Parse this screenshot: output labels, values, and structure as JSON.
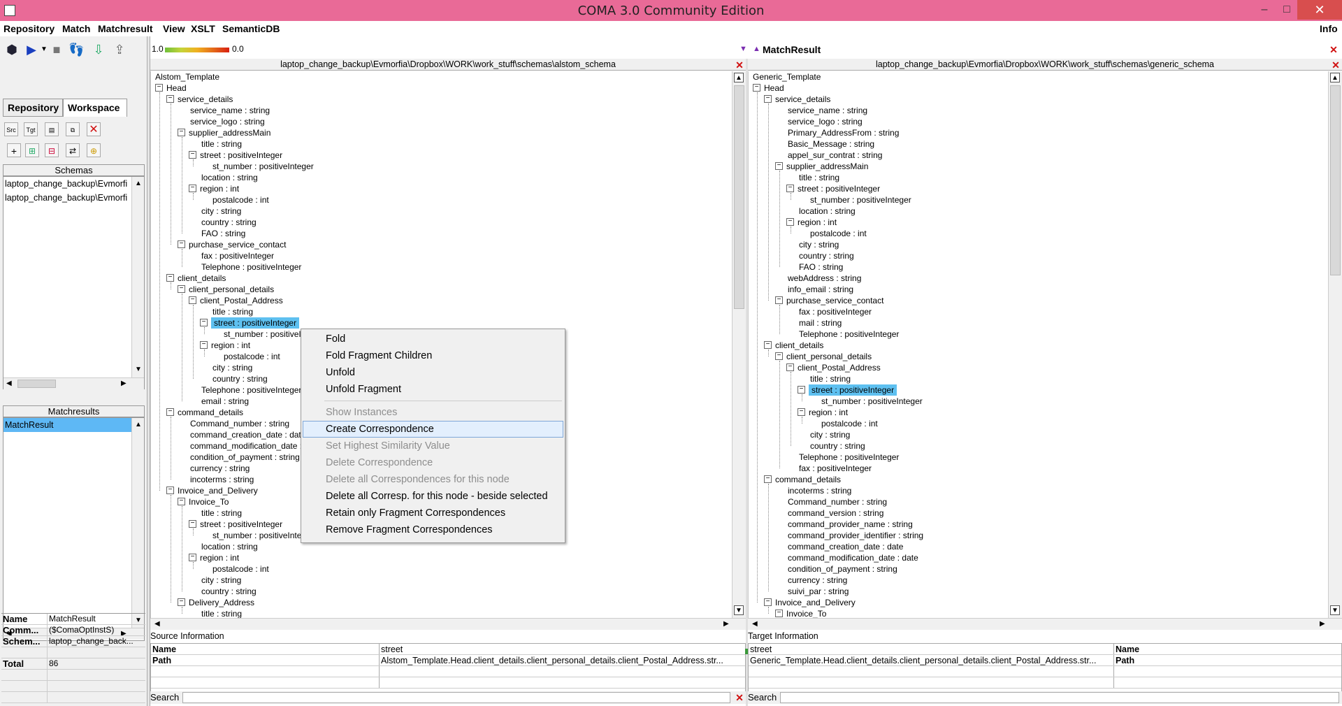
{
  "window": {
    "title": "COMA 3.0 Community Edition",
    "minimize": "–",
    "maximize": "□",
    "close": "✕"
  },
  "menu": [
    "Repository",
    "Match",
    "Matchresult",
    "View",
    "XSLT",
    "SemanticDB"
  ],
  "menu_right": "Info",
  "toolbar": {
    "scale_left": "1.0",
    "scale_right": "0.0"
  },
  "left_tabs": [
    "Repository",
    "Workspace"
  ],
  "schemas": {
    "header": "Schemas",
    "items": [
      "laptop_change_backup\\Evmorfi",
      "laptop_change_backup\\Evmorfi"
    ]
  },
  "matchresults": {
    "header": "Matchresults",
    "items": [
      "MatchResult"
    ]
  },
  "properties": [
    {
      "key": "Name",
      "value": "MatchResult"
    },
    {
      "key": "Comm...",
      "value": "($ComaOptInstS)"
    },
    {
      "key": "Schem...",
      "value": "laptop_change_back..."
    },
    {
      "key": "Total",
      "value": "86"
    }
  ],
  "matchresult_title": "MatchResult",
  "source": {
    "path": "laptop_change_backup\\Evmorfia\\Dropbox\\WORK\\work_stuff\\schemas\\alstom_schema",
    "tree": [
      {
        "t": "Alstom_Template",
        "l": 0,
        "e": null
      },
      {
        "t": "Head",
        "l": 0,
        "e": "-"
      },
      {
        "t": "service_details",
        "l": 1,
        "e": "-"
      },
      {
        "t": "service_name : string",
        "l": 2,
        "e": null
      },
      {
        "t": "service_logo : string",
        "l": 2,
        "e": null
      },
      {
        "t": "supplier_addressMain",
        "l": 2,
        "e": "-"
      },
      {
        "t": "title : string",
        "l": 3,
        "e": null
      },
      {
        "t": "street : positiveInteger",
        "l": 3,
        "e": "-"
      },
      {
        "t": "st_number : positiveInteger",
        "l": 4,
        "e": null
      },
      {
        "t": "location : string",
        "l": 3,
        "e": null
      },
      {
        "t": "region : int",
        "l": 3,
        "e": "-"
      },
      {
        "t": "postalcode : int",
        "l": 4,
        "e": null
      },
      {
        "t": "city : string",
        "l": 3,
        "e": null
      },
      {
        "t": "country : string",
        "l": 3,
        "e": null
      },
      {
        "t": "FAO : string",
        "l": 3,
        "e": null
      },
      {
        "t": "purchase_service_contact",
        "l": 2,
        "e": "-"
      },
      {
        "t": "fax : positiveInteger",
        "l": 3,
        "e": null
      },
      {
        "t": "Telephone : positiveInteger",
        "l": 3,
        "e": null
      },
      {
        "t": "client_details",
        "l": 1,
        "e": "-"
      },
      {
        "t": "client_personal_details",
        "l": 2,
        "e": "-"
      },
      {
        "t": "client_Postal_Address",
        "l": 3,
        "e": "-"
      },
      {
        "t": "title : string",
        "l": 4,
        "e": null
      },
      {
        "t": "street : positiveInteger",
        "l": 4,
        "e": "-",
        "sel": true
      },
      {
        "t": "st_number : positiveInteger",
        "l": 5,
        "e": null
      },
      {
        "t": "region : int",
        "l": 4,
        "e": "-"
      },
      {
        "t": "postalcode : int",
        "l": 5,
        "e": null
      },
      {
        "t": "city : string",
        "l": 4,
        "e": null
      },
      {
        "t": "country : string",
        "l": 4,
        "e": null
      },
      {
        "t": "Telephone : positiveInteger",
        "l": 3,
        "e": null
      },
      {
        "t": "email : string",
        "l": 3,
        "e": null
      },
      {
        "t": "command_details",
        "l": 1,
        "e": "-"
      },
      {
        "t": "Command_number : string",
        "l": 2,
        "e": null
      },
      {
        "t": "command_creation_date : date",
        "l": 2,
        "e": null
      },
      {
        "t": "command_modification_date : date",
        "l": 2,
        "e": null
      },
      {
        "t": "condition_of_payment : string",
        "l": 2,
        "e": null
      },
      {
        "t": "currency : string",
        "l": 2,
        "e": null
      },
      {
        "t": "incoterms : string",
        "l": 2,
        "e": null
      },
      {
        "t": "Invoice_and_Delivery",
        "l": 1,
        "e": "-"
      },
      {
        "t": "Invoice_To",
        "l": 2,
        "e": "-"
      },
      {
        "t": "title : string",
        "l": 3,
        "e": null
      },
      {
        "t": "street : positiveInteger",
        "l": 3,
        "e": "-"
      },
      {
        "t": "st_number : positiveInteger",
        "l": 4,
        "e": null
      },
      {
        "t": "location : string",
        "l": 3,
        "e": null
      },
      {
        "t": "region : int",
        "l": 3,
        "e": "-"
      },
      {
        "t": "postalcode : int",
        "l": 4,
        "e": null
      },
      {
        "t": "city : string",
        "l": 3,
        "e": null
      },
      {
        "t": "country : string",
        "l": 3,
        "e": null
      },
      {
        "t": "Delivery_Address",
        "l": 2,
        "e": "-"
      },
      {
        "t": "title : string",
        "l": 3,
        "e": null
      }
    ],
    "info_title": "Source Information",
    "info_rows": [
      {
        "k": "Name",
        "v": "street"
      },
      {
        "k": "Path",
        "v": "Alstom_Template.Head.client_details.client_personal_details.client_Postal_Address.str..."
      }
    ],
    "search_label": "Search"
  },
  "target": {
    "path": "laptop_change_backup\\Evmorfia\\Dropbox\\WORK\\work_stuff\\schemas\\generic_schema",
    "tree": [
      {
        "t": "Generic_Template",
        "l": 0,
        "e": null
      },
      {
        "t": "Head",
        "l": 0,
        "e": "-"
      },
      {
        "t": "service_details",
        "l": 1,
        "e": "-"
      },
      {
        "t": "service_name : string",
        "l": 2,
        "e": null
      },
      {
        "t": "service_logo : string",
        "l": 2,
        "e": null
      },
      {
        "t": "Primary_AddressFrom : string",
        "l": 2,
        "e": null
      },
      {
        "t": "Basic_Message : string",
        "l": 2,
        "e": null
      },
      {
        "t": "appel_sur_contrat : string",
        "l": 2,
        "e": null
      },
      {
        "t": "supplier_addressMain",
        "l": 2,
        "e": "-"
      },
      {
        "t": "title : string",
        "l": 3,
        "e": null
      },
      {
        "t": "street : positiveInteger",
        "l": 3,
        "e": "-"
      },
      {
        "t": "st_number : positiveInteger",
        "l": 4,
        "e": null
      },
      {
        "t": "location : string",
        "l": 3,
        "e": null
      },
      {
        "t": "region : int",
        "l": 3,
        "e": "-"
      },
      {
        "t": "postalcode : int",
        "l": 4,
        "e": null
      },
      {
        "t": "city : string",
        "l": 3,
        "e": null
      },
      {
        "t": "country : string",
        "l": 3,
        "e": null
      },
      {
        "t": "FAO : string",
        "l": 3,
        "e": null
      },
      {
        "t": "webAddress : string",
        "l": 2,
        "e": null
      },
      {
        "t": "info_email : string",
        "l": 2,
        "e": null
      },
      {
        "t": "purchase_service_contact",
        "l": 2,
        "e": "-"
      },
      {
        "t": "fax : positiveInteger",
        "l": 3,
        "e": null
      },
      {
        "t": "mail : string",
        "l": 3,
        "e": null
      },
      {
        "t": "Telephone : positiveInteger",
        "l": 3,
        "e": null
      },
      {
        "t": "client_details",
        "l": 1,
        "e": "-"
      },
      {
        "t": "client_personal_details",
        "l": 2,
        "e": "-"
      },
      {
        "t": "client_Postal_Address",
        "l": 3,
        "e": "-"
      },
      {
        "t": "title : string",
        "l": 4,
        "e": null
      },
      {
        "t": "street : positiveInteger",
        "l": 4,
        "e": "-",
        "sel": true
      },
      {
        "t": "st_number : positiveInteger",
        "l": 5,
        "e": null
      },
      {
        "t": "region : int",
        "l": 4,
        "e": "-"
      },
      {
        "t": "postalcode : int",
        "l": 5,
        "e": null
      },
      {
        "t": "city : string",
        "l": 4,
        "e": null
      },
      {
        "t": "country : string",
        "l": 4,
        "e": null
      },
      {
        "t": "Telephone : positiveInteger",
        "l": 3,
        "e": null
      },
      {
        "t": "fax : positiveInteger",
        "l": 3,
        "e": null
      },
      {
        "t": "command_details",
        "l": 1,
        "e": "-"
      },
      {
        "t": "incoterms : string",
        "l": 2,
        "e": null
      },
      {
        "t": "Command_number : string",
        "l": 2,
        "e": null
      },
      {
        "t": "command_version : string",
        "l": 2,
        "e": null
      },
      {
        "t": "command_provider_name : string",
        "l": 2,
        "e": null
      },
      {
        "t": "command_provider_identifier : string",
        "l": 2,
        "e": null
      },
      {
        "t": "command_creation_date : date",
        "l": 2,
        "e": null
      },
      {
        "t": "command_modification_date : date",
        "l": 2,
        "e": null
      },
      {
        "t": "condition_of_payment : string",
        "l": 2,
        "e": null
      },
      {
        "t": "currency : string",
        "l": 2,
        "e": null
      },
      {
        "t": "suivi_par : string",
        "l": 2,
        "e": null
      },
      {
        "t": "Invoice_and_Delivery",
        "l": 1,
        "e": "-"
      },
      {
        "t": "Invoice_To",
        "l": 2,
        "e": "-"
      }
    ],
    "info_title": "Target Information",
    "info_rows": [
      {
        "v": "street",
        "k": "Name"
      },
      {
        "v": "Generic_Template.Head.client_details.client_personal_details.client_Postal_Address.str...",
        "k": "Path"
      }
    ],
    "search_label": "Search"
  },
  "context_menu": [
    {
      "label": "Fold",
      "enabled": true
    },
    {
      "label": "Fold Fragment Children",
      "enabled": true
    },
    {
      "label": "Unfold",
      "enabled": true
    },
    {
      "label": "Unfold Fragment",
      "enabled": true
    },
    {
      "sep": true
    },
    {
      "label": "Show Instances",
      "enabled": false
    },
    {
      "label": "Create Correspondence",
      "enabled": true,
      "hot": true
    },
    {
      "label": "Set Highest Similarity Value",
      "enabled": false
    },
    {
      "label": "Delete Correspondence",
      "enabled": false
    },
    {
      "label": "Delete all Correspondences for this node",
      "enabled": false
    },
    {
      "label": "Delete all Corresp. for this node - beside selected",
      "enabled": true
    },
    {
      "label": "Retain only Fragment Correspondences",
      "enabled": true
    },
    {
      "label": "Remove Fragment Correspondences",
      "enabled": true
    }
  ],
  "colors": {
    "titlebar": "#e96a97",
    "selection": "#5ec0f0",
    "close_red": "#d01010"
  }
}
